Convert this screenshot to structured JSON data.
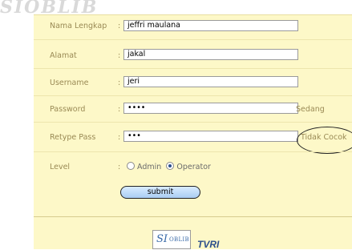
{
  "watermark": "SIOBLIB",
  "form": {
    "nama_label": "Nama Lengkap",
    "nama_value": "jeffri maulana",
    "alamat_label": "Alamat",
    "alamat_value": "jakal",
    "username_label": "Username",
    "username_value": "jeri",
    "password_label": "Password",
    "password_value": "••••",
    "password_strength": "Sedang",
    "retype_label": "Retype Pass",
    "retype_value": "•••",
    "retype_status": "Tidak Cocok",
    "level_label": "Level",
    "level_options": [
      "Admin",
      "Operator"
    ],
    "level_selected": "Operator",
    "colon": ":",
    "submit_label": "submit"
  },
  "footer": {
    "logo_big": "SI",
    "logo_small": "OBLIB",
    "tvri_text": "TVRI"
  }
}
